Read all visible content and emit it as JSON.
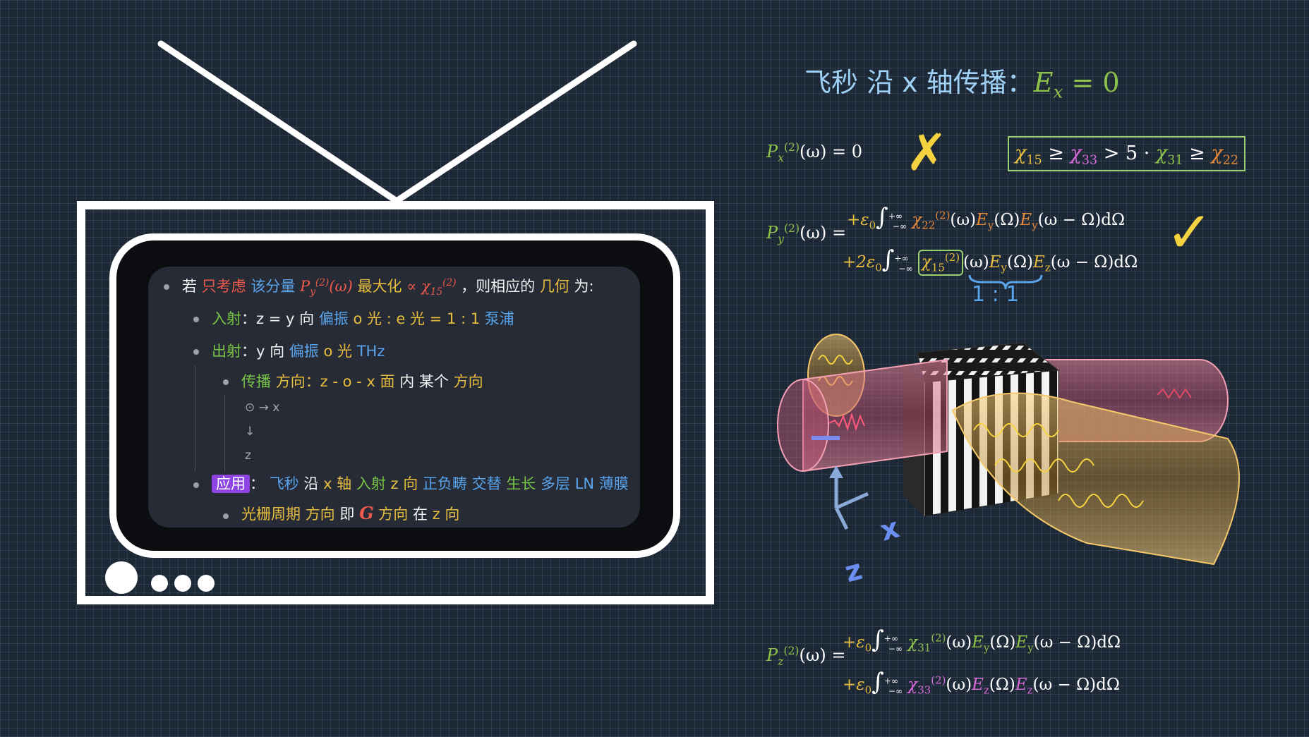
{
  "title": {
    "text": "飞秒 沿 x 轴传播：",
    "math": "E",
    "math_sub": "x",
    "math_rest": " = 0"
  },
  "screen": {
    "row1": {
      "a": "若",
      "b": "只考虑",
      "c": "该分量",
      "d": "P",
      "d_sub": "y",
      "d_sup": "(2)",
      "d_arg": "(ω)",
      "e": "最大化",
      "f": "∝ χ",
      "f_sub": "15",
      "f_sup": "(2)",
      "g": "，则相应的",
      "h": "几何",
      "i": "为:"
    },
    "row2": {
      "a": "入射",
      "b": "：z = y 向",
      "c": "偏振",
      "d": "o 光 : e 光 = 1 : 1",
      "e": "泵浦"
    },
    "row3": {
      "a": "出射",
      "b": "：y 向",
      "c": "偏振",
      "d": "o 光",
      "e": "THz"
    },
    "row4": {
      "a": "传播",
      "b": "方向",
      "c": "：z - o - x",
      "d": "面",
      "e": "内",
      "f": "某个",
      "g": "方向"
    },
    "axes": {
      "r1": "⊙ → x",
      "r2": "↓",
      "r3": "z"
    },
    "row5": {
      "tag": "应用",
      "a": "：",
      "b": "飞秒",
      "c": "沿",
      "d": "x 轴",
      "e": "入射",
      "f": "z 向",
      "g": "正负畴",
      "h": "交替",
      "i": "生长",
      "j": "多层",
      "k": "LN",
      "l": "薄膜"
    },
    "row6": {
      "a": "光栅周期",
      "b": "方向",
      "c": "即",
      "d": "G",
      "e": "方向",
      "f": "在",
      "g": "z 向"
    }
  },
  "right": {
    "px": {
      "lhs": "P",
      "lhs_sub": "x",
      "lhs_sup": "(2)",
      "rhs": "(ω) = 0",
      "mark": "✗"
    },
    "ineq": {
      "t1": "χ",
      "t1_sub": "15",
      "t2": " ≥ ",
      "t3": "χ",
      "t3_sub": "33",
      "t4": " > 5 · ",
      "t5": "χ",
      "t5_sub": "31",
      "t6": " ≥ ",
      "t7": "χ",
      "t7_sub": "22"
    },
    "py": {
      "lhs": "P",
      "lhs_sub": "y",
      "lhs_sup": "(2)",
      "lhs_rest": "(ω) =",
      "l1_pre": "+ε",
      "l1_pre_sub": "0",
      "l1_int": "∫",
      "l1_int_top": "+∞",
      "l1_int_bot": "−∞",
      "l1_chi": "χ",
      "l1_chi_sub": "22",
      "l1_chi_sup": "(2)",
      "l1_mid": "(ω)",
      "l1_e1": "E",
      "l1_e1_sub": "y",
      "l1_mid2": "(Ω)",
      "l1_e2": "E",
      "l1_e2_sub": "y",
      "l1_end": "(ω − Ω)dΩ",
      "l2_pre": "+2ε",
      "l2_pre_sub": "0",
      "l2_int": "∫",
      "l2_int_top": "+∞",
      "l2_int_bot": "−∞",
      "l2_chi": "χ",
      "l2_chi_sub": "15",
      "l2_chi_sup": "(2)",
      "l2_mid": "(ω)",
      "l2_e1": "E",
      "l2_e1_sub": "y",
      "l2_mid2": "(Ω)",
      "l2_e2": "E",
      "l2_e2_sub": "z",
      "l2_end": "(ω − Ω)dΩ",
      "ratio": "1 : 1",
      "mark": "✓"
    },
    "pz": {
      "lhs": "P",
      "lhs_sub": "z",
      "lhs_sup": "(2)",
      "lhs_rest": "(ω) =",
      "l1_pre": "+ε",
      "l1_pre_sub": "0",
      "l1_int": "∫",
      "l1_int_top": "+∞",
      "l1_int_bot": "−∞",
      "l1_chi": "χ",
      "l1_chi_sub": "31",
      "l1_chi_sup": "(2)",
      "l1_mid": "(ω)",
      "l1_e1": "E",
      "l1_e1_sub": "y",
      "l1_mid2": "(Ω)",
      "l1_e2": "E",
      "l1_e2_sub": "y",
      "l1_end": "(ω − Ω)dΩ",
      "l2_pre": "+ε",
      "l2_pre_sub": "0",
      "l2_int": "∫",
      "l2_int_top": "+∞",
      "l2_int_bot": "−∞",
      "l2_chi": "χ",
      "l2_chi_sub": "33",
      "l2_chi_sup": "(2)",
      "l2_mid": "(ω)",
      "l2_e1": "E",
      "l2_e1_sub": "z",
      "l2_mid2": "(Ω)",
      "l2_e2": "E",
      "l2_e2_sub": "z",
      "l2_end": "(ω − Ω)dΩ"
    },
    "axes3d": {
      "x": "x",
      "z": "z"
    }
  },
  "colors": {
    "background": "#1d2836",
    "tv_frame": "#ffffff",
    "screen": "#262b35",
    "gold": "#e6bd3e",
    "green": "#8dc34a",
    "magenta": "#d96bd9",
    "orange": "#e68a3a",
    "pink_beam": "#e07a92"
  }
}
